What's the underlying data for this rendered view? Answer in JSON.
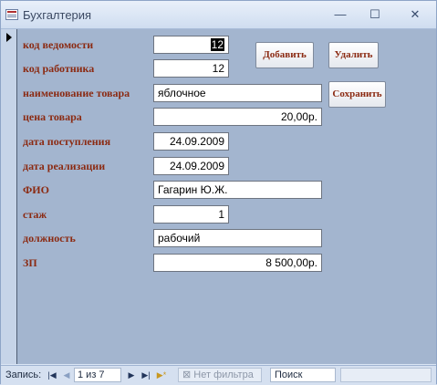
{
  "window": {
    "title": "Бухгалтерия",
    "minimize": "—",
    "maximize": "☐",
    "close": "✕"
  },
  "fields": {
    "vedomost": {
      "label": "код ведомости",
      "value": "12"
    },
    "rabotnik": {
      "label": "код работника",
      "value": "12"
    },
    "tovar": {
      "label": "наименование товара",
      "value": "яблочное"
    },
    "cena": {
      "label": "цена товара",
      "value": "20,00р."
    },
    "postuplenie": {
      "label": "дата поступления",
      "value": "24.09.2009"
    },
    "realizacia": {
      "label": "дата реализации",
      "value": "24.09.2009"
    },
    "fio": {
      "label": "ФИО",
      "value": "Гагарин Ю.Ж."
    },
    "stazh": {
      "label": "стаж",
      "value": "1"
    },
    "dolzhnost": {
      "label": "должность",
      "value": "рабочий"
    },
    "zp": {
      "label": "ЗП",
      "value": "8 500,00р."
    }
  },
  "buttons": {
    "add": "Добавить",
    "delete": "Удалить",
    "save": "Сохранить"
  },
  "nav": {
    "record_label": "Запись:",
    "first": "|◀",
    "prev": "◀",
    "next": "▶",
    "last": "▶|",
    "new": "▶*",
    "position": "1 из 7",
    "filter": "Нет фильтра",
    "search": "Поиск"
  }
}
